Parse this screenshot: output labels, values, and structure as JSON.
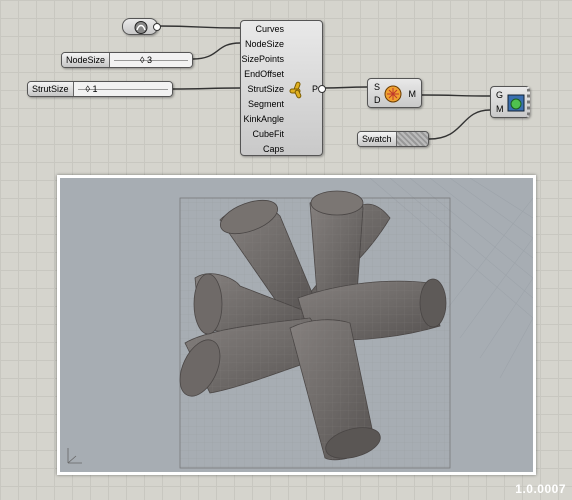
{
  "main_component": {
    "inputs": [
      "Curves",
      "NodeSize",
      "SizePoints",
      "EndOffset",
      "StrutSize",
      "Segment",
      "KinkAngle",
      "CubeFit",
      "Caps"
    ],
    "output": "P"
  },
  "sliders": [
    {
      "label": "NodeSize",
      "value": "◊ 3"
    },
    {
      "label": "StrutSize",
      "value": "◊ 1"
    }
  ],
  "preview_component": {
    "inputs": [
      "S",
      "D"
    ],
    "output": "M"
  },
  "swatch": {
    "label": "Swatch"
  },
  "material_component": {
    "inputs": [
      "G",
      "M"
    ]
  },
  "footer": {
    "version": "1.0.0007"
  },
  "colors": {
    "canvas": "#d5d4cd",
    "viewport_bg": "#a7adb3",
    "mesh": "#6e6a68",
    "wire": "#333333"
  },
  "icons": [
    "curve-param-icon",
    "exoskeleton-icon",
    "preview-icon",
    "display-icon"
  ]
}
